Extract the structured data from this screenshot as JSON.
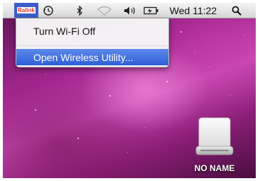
{
  "menubar": {
    "ralink_label": "Ralink",
    "bluetooth_symbol": "∦",
    "volume_symbol": "◀))",
    "clock": "Wed 11:22",
    "spotlight_symbol": "🔍",
    "icons": [
      "ralink-icon",
      "time-machine-icon",
      "bluetooth-icon",
      "wifi-icon",
      "volume-icon",
      "battery-icon",
      "spotlight-icon"
    ]
  },
  "dropdown": {
    "items": [
      {
        "label": "Turn Wi-Fi Off",
        "highlighted": false
      },
      {
        "label": "Open Wireless Utility...",
        "highlighted": true
      }
    ],
    "highlight_color": "#3a6be0"
  },
  "desktop": {
    "drive_label": "NO NAME",
    "wallpaper_colors": [
      "#5a1450",
      "#c94bb4",
      "#4a0d3f"
    ]
  }
}
